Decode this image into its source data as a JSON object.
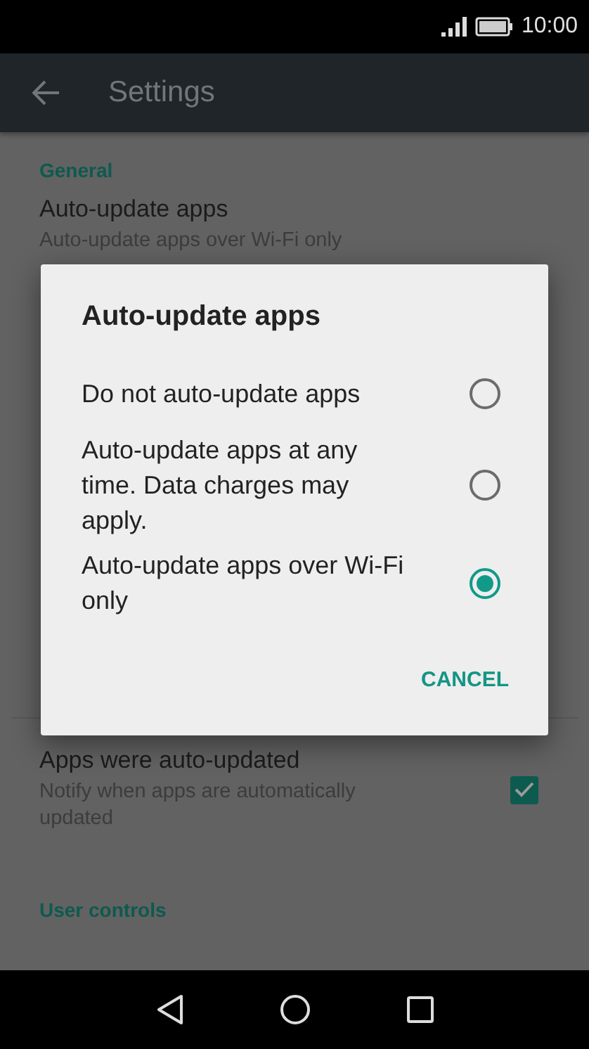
{
  "status_bar": {
    "time": "10:00"
  },
  "app_bar": {
    "title": "Settings"
  },
  "sections": [
    {
      "header": "General",
      "rows": [
        {
          "title": "Auto-update apps",
          "subtitle": "Auto-update apps over Wi-Fi only"
        }
      ]
    },
    {
      "rows": [
        {
          "kind": "checkbox",
          "title": "Apps were auto-updated",
          "subtitle": "Notify when apps are automatically updated",
          "checked": true
        }
      ]
    },
    {
      "header": "User controls"
    }
  ],
  "dialog": {
    "title": "Auto-update apps",
    "options": [
      {
        "label": "Do not auto-update apps",
        "selected": false
      },
      {
        "label": "Auto-update apps at any time. Data charges may apply.",
        "selected": false
      },
      {
        "label": "Auto-update apps over Wi-Fi only",
        "selected": true
      }
    ],
    "button": "CANCEL"
  }
}
